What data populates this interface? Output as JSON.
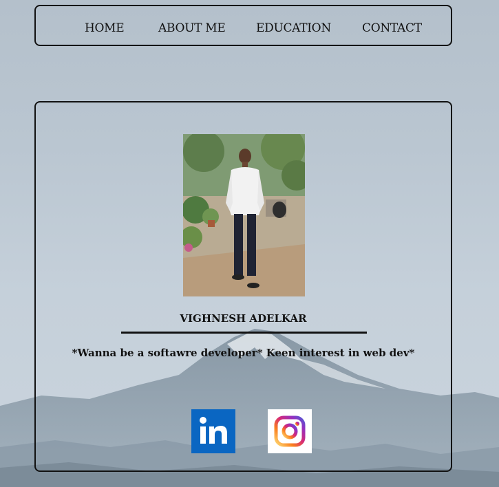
{
  "nav": {
    "items": [
      {
        "label": "HOME"
      },
      {
        "label": "ABOUT ME"
      },
      {
        "label": "EDUCATION"
      },
      {
        "label": "CONTACT"
      }
    ]
  },
  "profile": {
    "name": "VIGHNESH ADELKAR",
    "tagline": "*Wanna be a softawre developer* Keen interest in web dev*"
  },
  "social": [
    {
      "icon": "linkedin-icon",
      "color": "#0a66c2"
    },
    {
      "icon": "instagram-icon",
      "color": "#e1306c"
    }
  ]
}
